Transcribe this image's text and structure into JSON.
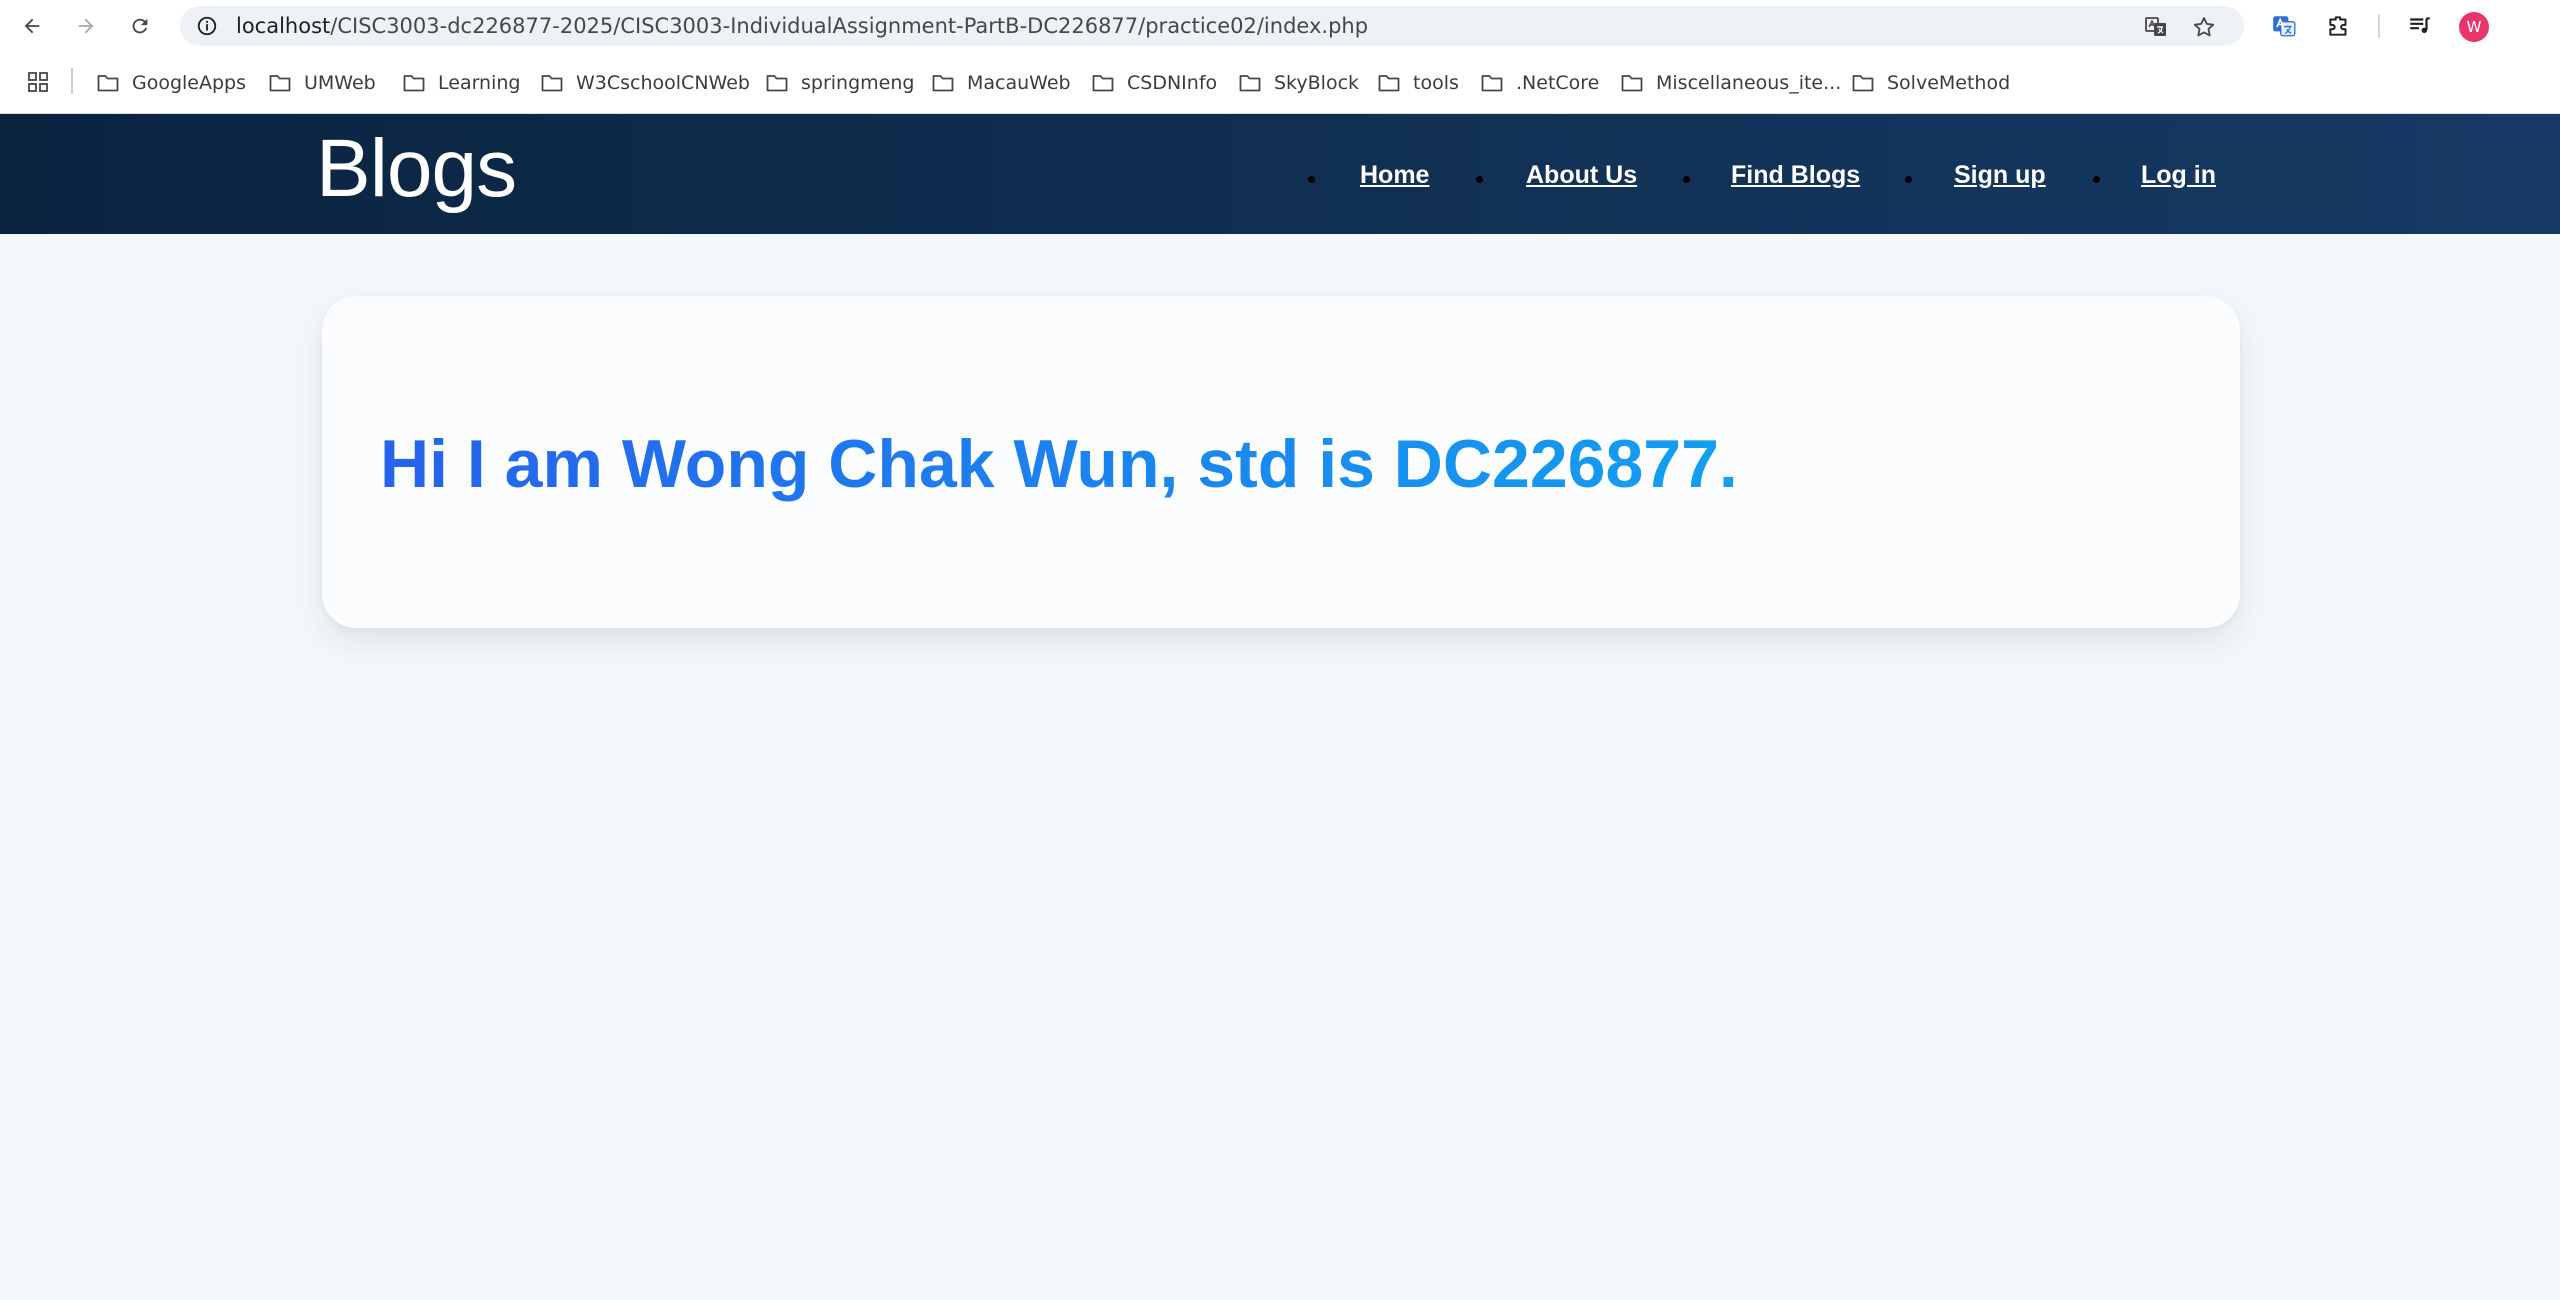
{
  "browser": {
    "url_host": "localhost",
    "url_path": "/CISC3003-dc226877-2025/CISC3003-IndividualAssignment-PartB-DC226877/practice02/index.php",
    "profile_initial": "W"
  },
  "bookmarks": [
    {
      "label": "GoogleApps"
    },
    {
      "label": "UMWeb"
    },
    {
      "label": "Learning"
    },
    {
      "label": "W3CschoolCNWeb"
    },
    {
      "label": "springmeng"
    },
    {
      "label": "MacauWeb"
    },
    {
      "label": "CSDNInfo"
    },
    {
      "label": "SkyBlock"
    },
    {
      "label": "tools"
    },
    {
      "label": ".NetCore"
    },
    {
      "label": "Miscellaneous_ite..."
    },
    {
      "label": "SolveMethod"
    }
  ],
  "site": {
    "brand": "Blogs",
    "nav": [
      {
        "label": "Home"
      },
      {
        "label": "About Us"
      },
      {
        "label": "Find Blogs"
      },
      {
        "label": "Sign up"
      },
      {
        "label": "Log in"
      }
    ]
  },
  "main": {
    "greeting": "Hi I am Wong Chak Wun, std is DC226877."
  },
  "colors": {
    "header_start": "#0a2440",
    "header_end": "#163a64",
    "greeting_start": "#2563eb",
    "greeting_end": "#139ff0",
    "page_bg": "#f5f8fb"
  }
}
